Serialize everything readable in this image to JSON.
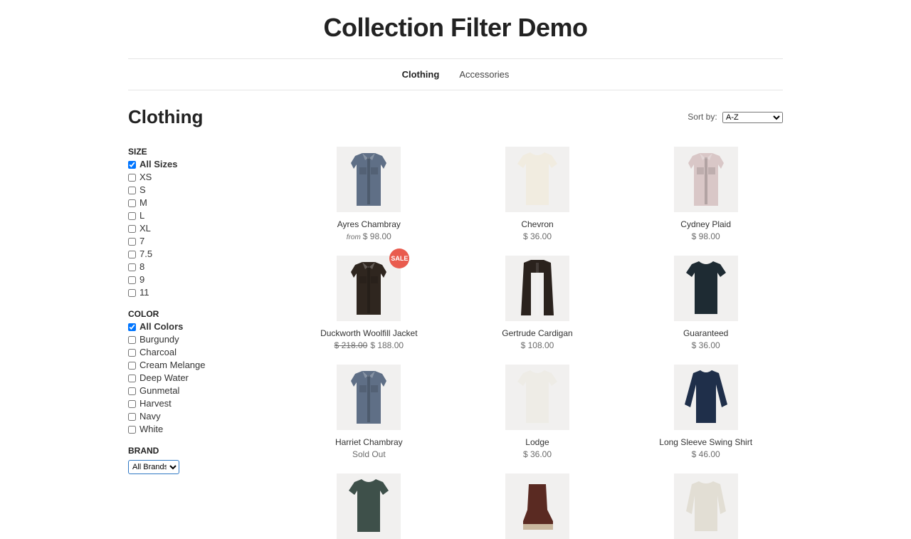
{
  "title": "Collection Filter Demo",
  "nav": [
    {
      "label": "Clothing",
      "active": true
    },
    {
      "label": "Accessories",
      "active": false
    }
  ],
  "collection_title": "Clothing",
  "sort": {
    "label": "Sort by:",
    "selected": "A-Z"
  },
  "filters": {
    "size": {
      "heading": "SIZE",
      "options": [
        {
          "label": "All Sizes",
          "checked": true
        },
        {
          "label": "XS",
          "checked": false
        },
        {
          "label": "S",
          "checked": false
        },
        {
          "label": "M",
          "checked": false
        },
        {
          "label": "L",
          "checked": false
        },
        {
          "label": "XL",
          "checked": false
        },
        {
          "label": "7",
          "checked": false
        },
        {
          "label": "7.5",
          "checked": false
        },
        {
          "label": "8",
          "checked": false
        },
        {
          "label": "9",
          "checked": false
        },
        {
          "label": "11",
          "checked": false
        }
      ]
    },
    "color": {
      "heading": "COLOR",
      "options": [
        {
          "label": "All Colors",
          "checked": true
        },
        {
          "label": "Burgundy",
          "checked": false
        },
        {
          "label": "Charcoal",
          "checked": false
        },
        {
          "label": "Cream Melange",
          "checked": false
        },
        {
          "label": "Deep Water",
          "checked": false
        },
        {
          "label": "Gunmetal",
          "checked": false
        },
        {
          "label": "Harvest",
          "checked": false
        },
        {
          "label": "Navy",
          "checked": false
        },
        {
          "label": "White",
          "checked": false
        }
      ]
    },
    "brand": {
      "heading": "BRAND",
      "selected": "All Brands"
    }
  },
  "sale_badge": "SALE",
  "products": [
    {
      "name": "Ayres Chambray",
      "price": "$ 98.00",
      "from": true,
      "img": "shirt",
      "fill": "#5f6f86",
      "collar": true
    },
    {
      "name": "Chevron",
      "price": "$ 36.00",
      "img": "tee",
      "fill": "#f1ece0"
    },
    {
      "name": "Cydney Plaid",
      "price": "$ 98.00",
      "img": "shirt",
      "fill": "#d9c7c7",
      "collar": true
    },
    {
      "name": "Duckworth Woolfill Jacket",
      "price": "$ 188.00",
      "compare": "$ 218.00",
      "sale": true,
      "img": "jacket",
      "fill": "#2f261f",
      "collar": true
    },
    {
      "name": "Gertrude Cardigan",
      "price": "$ 108.00",
      "img": "cardigan",
      "fill": "#2a221d"
    },
    {
      "name": "Guaranteed",
      "price": "$ 36.00",
      "img": "tee",
      "fill": "#1e2b33"
    },
    {
      "name": "Harriet Chambray",
      "soldout": "Sold Out",
      "img": "shirt",
      "fill": "#5f6f86",
      "collar": true
    },
    {
      "name": "Lodge",
      "price": "$ 36.00",
      "img": "tee",
      "fill": "#eeece6"
    },
    {
      "name": "Long Sleeve Swing Shirt",
      "price": "$ 46.00",
      "img": "longsleeve",
      "fill": "#1f2f4a"
    },
    {
      "name": "",
      "img": "tee",
      "fill": "#3e504a",
      "partial": true
    },
    {
      "name": "",
      "img": "boot",
      "fill": "#5a2a22",
      "partial": true
    },
    {
      "name": "",
      "img": "sweater",
      "fill": "#e2ded4",
      "partial": true
    }
  ]
}
